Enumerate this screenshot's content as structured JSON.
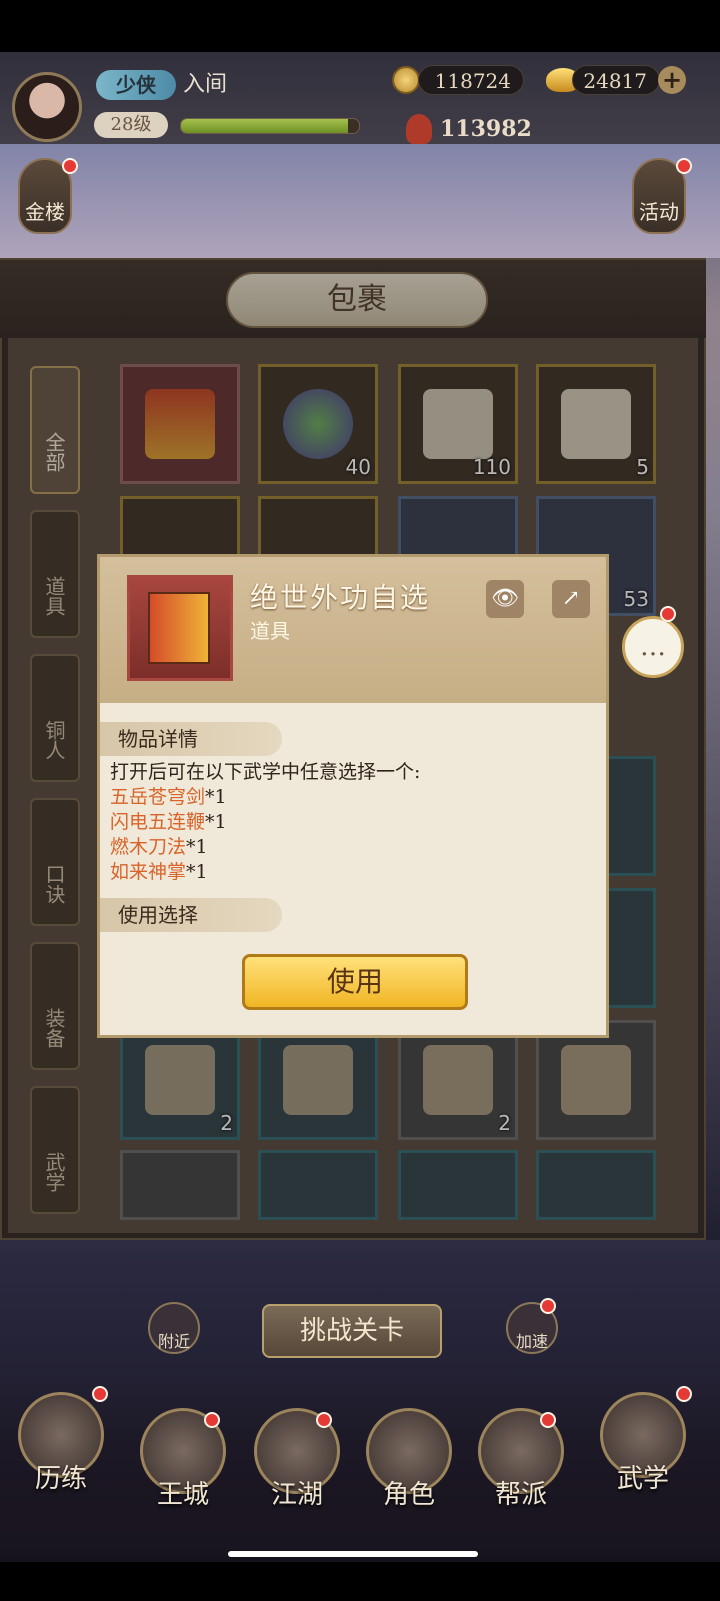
{
  "player": {
    "rank_badge": "少侠",
    "rank_title": "入间",
    "level": "28级",
    "xp_fraction": 0.94,
    "coins": "118724",
    "gold": "24817",
    "power": "113982"
  },
  "side_buttons": {
    "left": "金楼",
    "right": "活动"
  },
  "panel": {
    "title": "包裹",
    "tabs": [
      {
        "label": "全部",
        "active": true
      },
      {
        "label": "道具",
        "active": false
      },
      {
        "label": "铜人",
        "active": false
      },
      {
        "label": "口诀",
        "active": false
      },
      {
        "label": "装备",
        "active": false
      },
      {
        "label": "武学",
        "active": false
      }
    ],
    "slots_row1": [
      "",
      "40",
      "110",
      "5"
    ],
    "slots_row2_last": "53",
    "slots_row_manuals": [
      "2",
      "",
      "2",
      ""
    ]
  },
  "dialog": {
    "item_name": "绝世外功自选",
    "item_type": "道具",
    "details_header": "物品详情",
    "description": "打开后可在以下武学中任意选择一个:",
    "options": [
      {
        "name": "五岳苍穹剑",
        "qty": "*1"
      },
      {
        "name": "闪电五连鞭",
        "qty": "*1"
      },
      {
        "name": "燃木刀法",
        "qty": "*1"
      },
      {
        "name": "如来神掌",
        "qty": "*1"
      }
    ],
    "use_header": "使用选择",
    "use_button": "使用"
  },
  "bottom": {
    "challenge": "挑战关卡",
    "nearby": "附近",
    "speedup": "加速",
    "nav": [
      "历练",
      "王城",
      "江湖",
      "角色",
      "帮派",
      "武学"
    ]
  },
  "colors": {
    "accent_orange": "#d9642a",
    "gold_button": "#f1b524",
    "red_dot": "#e53935"
  }
}
